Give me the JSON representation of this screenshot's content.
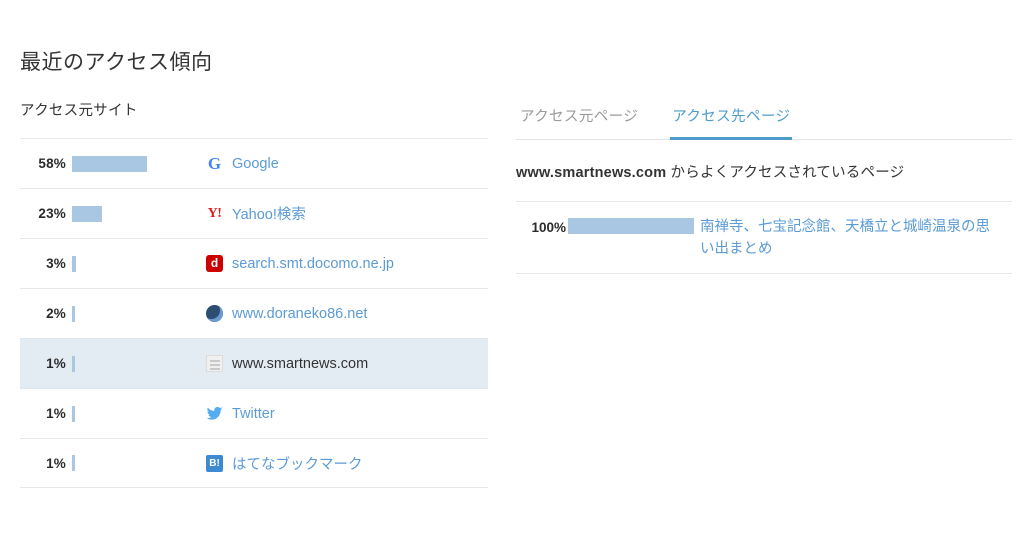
{
  "page": {
    "title": "最近のアクセス傾向",
    "subtitle": "アクセス元サイト",
    "accent_color": "#5b9bd5",
    "bar_color": "#a9c6e3",
    "selected_row_bg": "#e3ecf3"
  },
  "chart_data": {
    "type": "bar",
    "title": "アクセス元サイト",
    "xlabel": "",
    "ylabel": "",
    "categories": [
      "Google",
      "Yahoo!検索",
      "search.smt.docomo.ne.jp",
      "www.doraneko86.net",
      "www.smartnews.com",
      "Twitter",
      "はてなブックマーク"
    ],
    "values": [
      58,
      23,
      3,
      2,
      1,
      1,
      1
    ],
    "value_labels": [
      "58%",
      "23%",
      "3%",
      "2%",
      "1%",
      "1%",
      "1%"
    ],
    "ylim": [
      0,
      100
    ],
    "grid": false,
    "legend": "none",
    "orientation": "horizontal",
    "selected_index": 4
  },
  "sources": {
    "rows": [
      {
        "percent": "58%",
        "value": 58,
        "label": "Google",
        "icon": "google-icon",
        "glyph": "G",
        "selected": false
      },
      {
        "percent": "23%",
        "value": 23,
        "label": "Yahoo!検索",
        "icon": "yahoo-icon",
        "glyph": "Y!",
        "selected": false
      },
      {
        "percent": "3%",
        "value": 3,
        "label": "search.smt.docomo.ne.jp",
        "icon": "docomo-icon",
        "glyph": "d",
        "selected": false
      },
      {
        "percent": "2%",
        "value": 2,
        "label": "www.doraneko86.net",
        "icon": "doraneko-icon",
        "glyph": "",
        "selected": false
      },
      {
        "percent": "1%",
        "value": 1,
        "label": "www.smartnews.com",
        "icon": "smartnews-icon",
        "glyph": "",
        "selected": true
      },
      {
        "percent": "1%",
        "value": 1,
        "label": "Twitter",
        "icon": "twitter-icon",
        "glyph": "🐦",
        "selected": false
      },
      {
        "percent": "1%",
        "value": 1,
        "label": "はてなブックマーク",
        "icon": "hatena-bookmark-icon",
        "glyph": "B!",
        "selected": false
      }
    ]
  },
  "detail": {
    "tabs": [
      {
        "label": "アクセス元ページ",
        "active": false
      },
      {
        "label": "アクセス先ページ",
        "active": true
      }
    ],
    "heading_domain": "www.smartnews.com",
    "heading_rest": " からよくアクセスされているページ",
    "pages": [
      {
        "percent": "100%",
        "value": 100,
        "label": "南禅寺、七宝記念館、天橋立と城崎温泉の思い出まとめ"
      }
    ]
  }
}
